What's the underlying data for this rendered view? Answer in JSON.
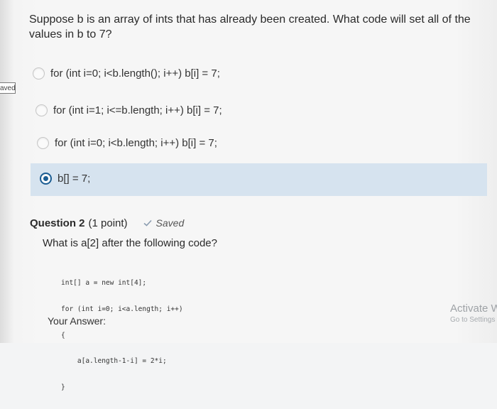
{
  "sidebar": {
    "saved_tab_label": "aved"
  },
  "question1": {
    "text": "Suppose b is an array of ints that has already been created. What code will set all of the values in b to 7?",
    "options": [
      {
        "label": "for (int i=0; i<b.length(); i++) b[i] = 7;",
        "selected": false
      },
      {
        "label": "for (int i=1; i<=b.length; i++) b[i] = 7;",
        "selected": false
      },
      {
        "label": "for (int i=0; i<b.length; i++) b[i] = 7;",
        "selected": false
      },
      {
        "label": "b[] = 7;",
        "selected": true
      }
    ]
  },
  "question2": {
    "number_label": "Question 2",
    "points_label": "(1 point)",
    "saved_label": "Saved",
    "text": "What is a[2] after the following code?",
    "code_lines": [
      "int[] a = new int[4];",
      "for (int i=0; i<a.length; i++)",
      "{",
      "    a[a.length-1-i] = 2*i;",
      "}"
    ],
    "answer_label": "Your Answer:"
  },
  "watermark": {
    "title": "Activate W",
    "subtitle": "Go to Settings"
  },
  "colors": {
    "accent": "#1b5d93",
    "selected_row": "#d6e3ef",
    "saved_check": "#8a9cb0"
  }
}
